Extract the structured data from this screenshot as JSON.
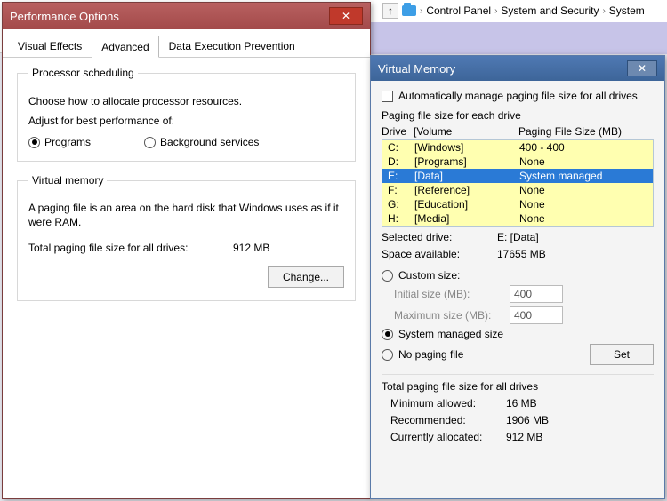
{
  "breadcrumb": {
    "item1": "Control Panel",
    "item2": "System and Security",
    "item3": "System"
  },
  "perf": {
    "title": "Performance Options",
    "tabs": {
      "visual": "Visual Effects",
      "advanced": "Advanced",
      "dep": "Data Execution Prevention"
    },
    "proc_sched": {
      "legend": "Processor scheduling",
      "help": "Choose how to allocate processor resources.",
      "adjust": "Adjust for best performance of:",
      "programs": "Programs",
      "bgservices": "Background services"
    },
    "vm": {
      "legend": "Virtual memory",
      "desc": "A paging file is an area on the hard disk that Windows uses as if it were RAM.",
      "total_label": "Total paging file size for all drives:",
      "total_value": "912 MB",
      "change_btn": "Change..."
    }
  },
  "vm": {
    "title": "Virtual Memory",
    "auto_label": "Automatically manage paging file size for all drives",
    "pf_each": "Paging file size for each drive",
    "hdr": {
      "drive": "Drive",
      "volume": "[Volume",
      "size": "Paging File Size (MB)"
    },
    "drives": [
      {
        "d": "C:",
        "vol": "[Windows]",
        "size": "400 - 400"
      },
      {
        "d": "D:",
        "vol": "[Programs]",
        "size": "None"
      },
      {
        "d": "E:",
        "vol": "[Data]",
        "size": "System managed"
      },
      {
        "d": "F:",
        "vol": "[Reference]",
        "size": "None"
      },
      {
        "d": "G:",
        "vol": "[Education]",
        "size": "None"
      },
      {
        "d": "H:",
        "vol": "[Media]",
        "size": "None"
      }
    ],
    "selected_label": "Selected drive:",
    "selected_value": "E:  [Data]",
    "space_label": "Space available:",
    "space_value": "17655 MB",
    "custom": "Custom size:",
    "init_label": "Initial size (MB):",
    "init_value": "400",
    "max_label": "Maximum size (MB):",
    "max_value": "400",
    "sys_managed": "System managed size",
    "no_pf": "No paging file",
    "set_btn": "Set",
    "totals_title": "Total paging file size for all drives",
    "min_label": "Minimum allowed:",
    "min_value": "16 MB",
    "rec_label": "Recommended:",
    "rec_value": "1906 MB",
    "cur_label": "Currently allocated:",
    "cur_value": "912 MB"
  }
}
